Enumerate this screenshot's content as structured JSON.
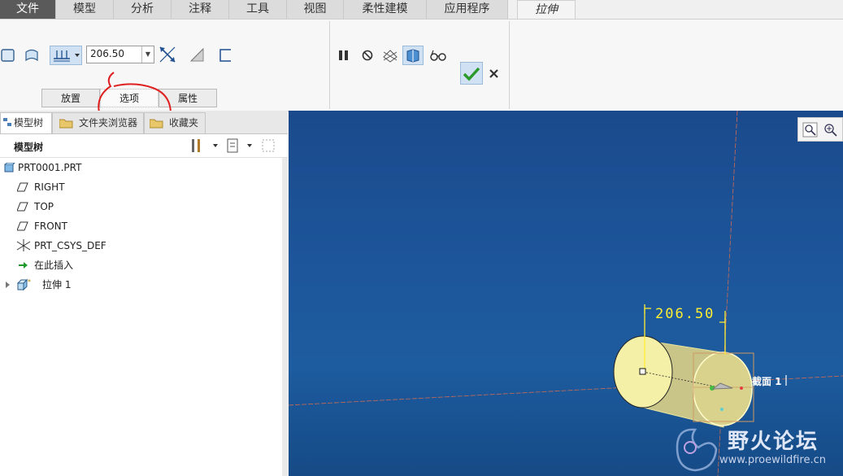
{
  "menu": {
    "tabs": [
      "文件",
      "模型",
      "分析",
      "注释",
      "工具",
      "视图",
      "柔性建模",
      "应用程序"
    ],
    "active_tab": "拉伸"
  },
  "ribbon": {
    "depth_value": "206.50",
    "panel_tabs": [
      "放置",
      "选项",
      "属性"
    ]
  },
  "left_panel": {
    "tabs": [
      "模型树",
      "文件夹浏览器",
      "收藏夹"
    ],
    "tree_title": "模型树",
    "tree_items": [
      {
        "label": "PRT0001.PRT",
        "icon": "part-icon"
      },
      {
        "label": "RIGHT",
        "icon": "datum-plane-icon"
      },
      {
        "label": "TOP",
        "icon": "datum-plane-icon"
      },
      {
        "label": "FRONT",
        "icon": "datum-plane-icon"
      },
      {
        "label": "PRT_CSYS_DEF",
        "icon": "csys-icon"
      },
      {
        "label": "在此插入",
        "icon": "insert-here-icon"
      },
      {
        "label": "拉伸 1",
        "icon": "extrude-icon"
      }
    ]
  },
  "viewport": {
    "dimension_label": "206.50",
    "section_label": "截面 1",
    "watermark_cn": "野火论坛",
    "watermark_url": "www.proewildfire.cn"
  },
  "colors": {
    "viewport_bg": "#1d559a",
    "confirm_green": "#2a9a2a",
    "annotation_red": "#e02020",
    "model_yellow": "#f5f0a8"
  }
}
